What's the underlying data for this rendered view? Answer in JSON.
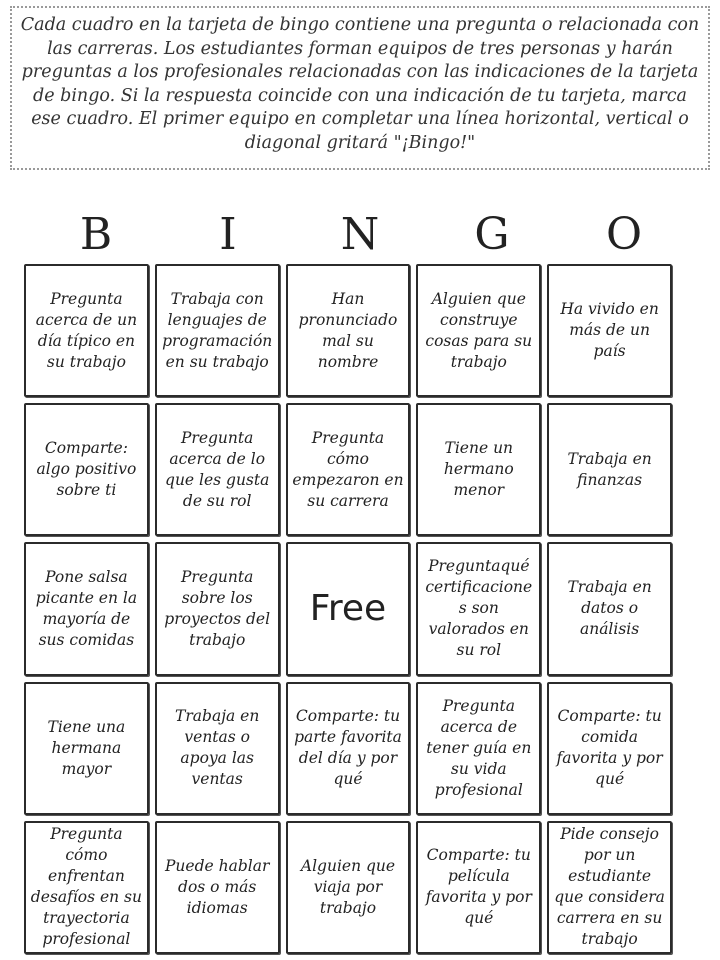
{
  "instructions": "Cada cuadro en la tarjeta de bingo contiene una pregunta o relacionada con las carreras. Los estudiantes forman equipos de tres personas y harán preguntas a los profesionales relacionadas con las indicaciones de la tarjeta de bingo. Si la respuesta coincide con una indicación de tu tarjeta, marca ese cuadro. El primer equipo en completar una línea horizontal, vertical o diagonal gritará \"¡Bingo!\"",
  "header_letters": [
    "B",
    "I",
    "N",
    "G",
    "O"
  ],
  "cells": [
    "Pregunta acerca de un día típico en su trabajo",
    "Trabaja con lenguajes de programación en su trabajo",
    "Han pronunciado mal su nombre",
    "Alguien que construye cosas para su trabajo",
    "Ha vivido en más de un país",
    "Comparte: algo positivo sobre ti",
    "Pregunta acerca de lo que les gusta de su rol",
    "Pregunta cómo empezaron en su carrera",
    "Tiene un hermano menor",
    "Trabaja en finanzas",
    "Pone salsa picante en la mayoría de sus comidas",
    "Pregunta sobre los proyectos del trabajo",
    "Free",
    "Preguntaqué certificaciones son valorados en su rol",
    "Trabaja en datos o análisis",
    "Tiene una hermana mayor",
    "Trabaja en ventas o apoya las ventas",
    "Comparte: tu parte favorita del día y por qué",
    "Pregunta acerca de tener guía en su vida profesional",
    "Comparte: tu comida favorita y por qué",
    "Pregunta cómo enfrentan desafíos en su trayectoria profesional",
    "Puede hablar dos o más idiomas",
    "Alguien que viaja por trabajo",
    "Comparte: tu película favorita y por qué",
    "Pide consejo por un estudiante que considera carrera en su trabajo"
  ]
}
